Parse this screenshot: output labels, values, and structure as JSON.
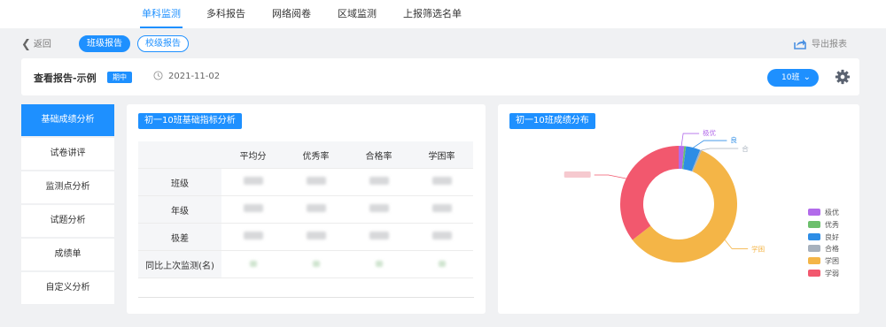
{
  "nav": {
    "tabs": [
      "单科监测",
      "多科报告",
      "网络阅卷",
      "区域监测",
      "上报筛选名单"
    ],
    "active_index": 0
  },
  "toolbar": {
    "back_label": "返回",
    "class_report_label": "班级报告",
    "school_report_label": "校级报告",
    "export_label": "导出报表"
  },
  "header": {
    "title": "查看报告-示例",
    "badge": "期中",
    "date": "2021-11-02",
    "class_select": "10班"
  },
  "sidebar": {
    "items": [
      "基础成绩分析",
      "试卷讲评",
      "监测点分析",
      "试题分析",
      "成绩单",
      "自定义分析"
    ],
    "active_index": 0
  },
  "metrics": {
    "title": "初一10班基础指标分析",
    "columns": [
      "平均分",
      "优秀率",
      "合格率",
      "学困率"
    ],
    "rows": [
      "班级",
      "年级",
      "极差",
      "同比上次监测(名)"
    ]
  },
  "distribution": {
    "title": "初一10班成绩分布",
    "callouts": {
      "excellent": "极优",
      "good": "良",
      "pass": "合",
      "poor": "学困"
    }
  },
  "chart_data": {
    "type": "pie",
    "title": "初一10班成绩分布",
    "donut": true,
    "legend_position": "right",
    "categories": [
      "极优",
      "优秀",
      "良好",
      "合格",
      "学困",
      "学弱"
    ],
    "values": [
      1.5,
      0.5,
      4,
      0.5,
      58,
      35.5
    ],
    "colors": [
      "#b26bea",
      "#6cbf6c",
      "#2d8de6",
      "#a7b1bd",
      "#f4b547",
      "#f2586e"
    ]
  }
}
